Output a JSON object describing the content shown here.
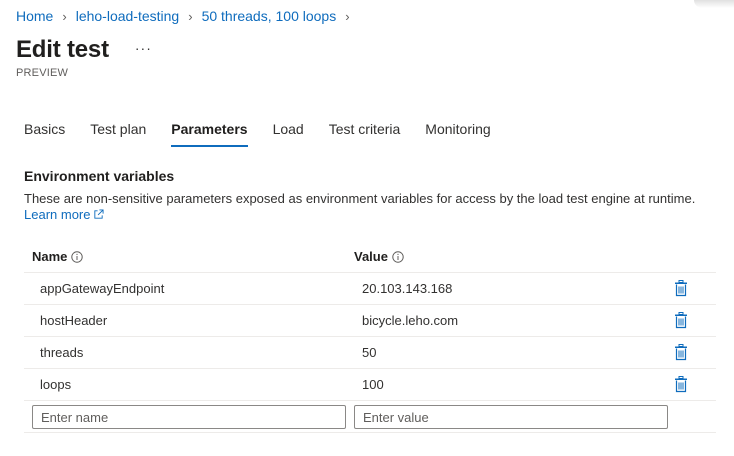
{
  "breadcrumb": [
    "Home",
    "leho-load-testing",
    "50 threads, 100 loops"
  ],
  "page": {
    "title": "Edit test",
    "more": "···",
    "subtitle": "PREVIEW"
  },
  "tabs": [
    {
      "label": "Basics",
      "active": false
    },
    {
      "label": "Test plan",
      "active": false
    },
    {
      "label": "Parameters",
      "active": true
    },
    {
      "label": "Load",
      "active": false
    },
    {
      "label": "Test criteria",
      "active": false
    },
    {
      "label": "Monitoring",
      "active": false
    }
  ],
  "env": {
    "title": "Environment variables",
    "description": "These are non-sensitive parameters exposed as environment variables for access by the load test engine at runtime.",
    "learn_more": "Learn more"
  },
  "table": {
    "col_name": "Name",
    "col_value": "Value",
    "rows": [
      {
        "name": "appGatewayEndpoint",
        "value": "20.103.143.168"
      },
      {
        "name": "hostHeader",
        "value": "bicycle.leho.com"
      },
      {
        "name": "threads",
        "value": "50"
      },
      {
        "name": "loops",
        "value": "100"
      }
    ],
    "name_placeholder": "Enter name",
    "value_placeholder": "Enter value"
  },
  "colors": {
    "link": "#0f6cbd",
    "text": "#323130",
    "border": "#edebe9"
  },
  "icons": {
    "info": "info-icon",
    "delete": "trash-icon",
    "external": "external-link-icon"
  }
}
